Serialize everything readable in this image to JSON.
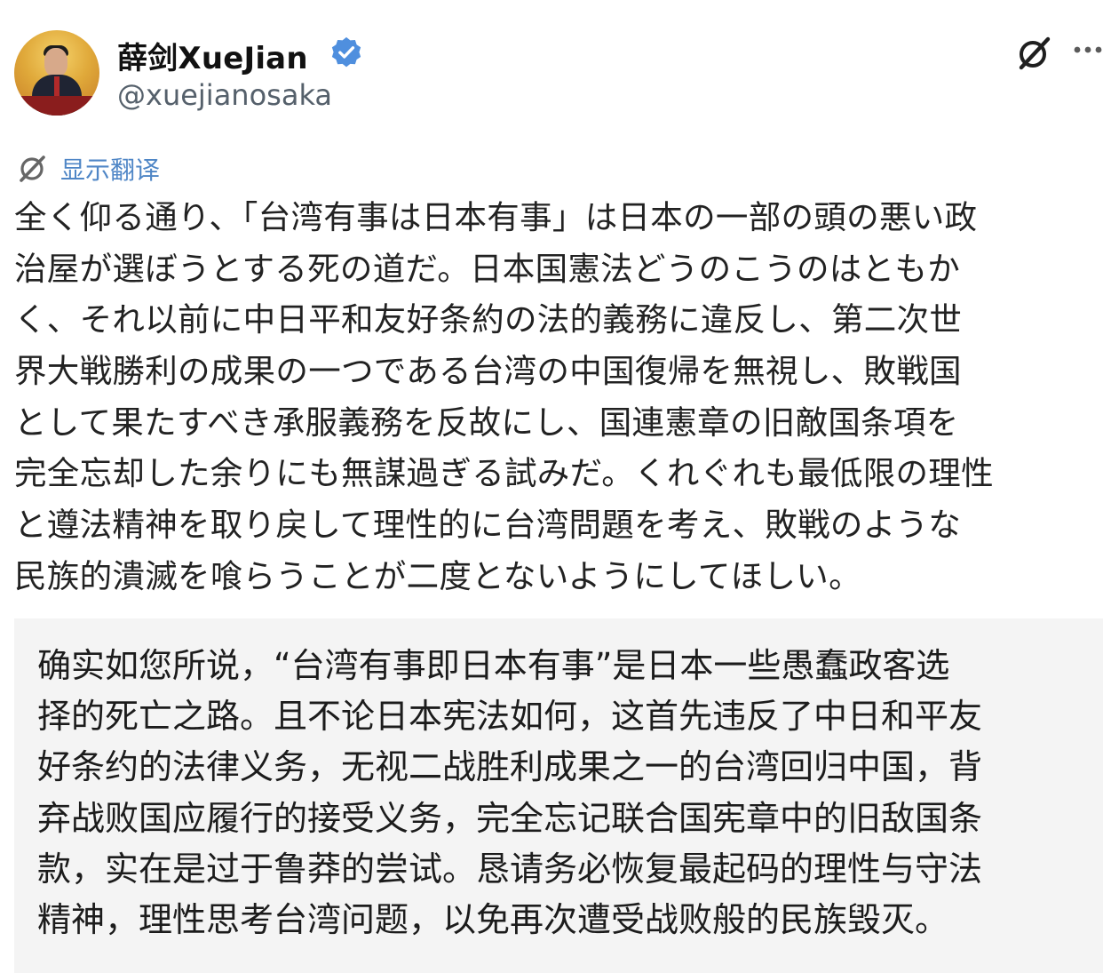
{
  "author": {
    "display_name": "薛剑XueJian",
    "handle": "@xuejianosaka",
    "verified": true,
    "avatar_icon": "avatar-portrait",
    "verified_color": "#4f8fde"
  },
  "actions": {
    "grok_icon": "grok-icon",
    "more_icon": "more-icon"
  },
  "translate": {
    "label": "显示翻译",
    "icon": "translate-icon",
    "link_color": "#4f86c6"
  },
  "post": {
    "lines": [
      "全く仰る通り、「台湾有事は日本有事」は日本の一部の頭の悪い政",
      "治屋が選ぼうとする死の道だ。日本国憲法どうのこうのはともか",
      "く、それ以前に中日平和友好条約の法的義務に違反し、第二次世",
      "界大戦勝利の成果の一つである台湾の中国復帰を無視し、敗戦国",
      "として果たすべき承服義務を反故にし、国連憲章の旧敵国条項を",
      "完全忘却した余りにも無謀過ぎる試みだ。くれぐれも最低限の理性",
      "と遵法精神を取り戻して理性的に台湾問題を考え、敗戦のような",
      "民族的潰滅を喰らうことが二度とないようにしてほしい。"
    ]
  },
  "translation": {
    "lines": [
      "确实如您所说，“台湾有事即日本有事”是日本一些愚蠢政客选",
      "择的死亡之路。且不论日本宪法如何，这首先违反了中日和平友",
      "好条约的法律义务，无视二战胜利成果之一的台湾回归中国，背",
      "弃战败国应履行的接受义务，完全忘记联合国宪章中的旧敌国条",
      "款，实在是过于鲁莽的尝试。恳请务必恢复最起码的理性与守法",
      "精神，理性思考台湾问题，以免再次遭受战败般的民族毁灭。"
    ]
  }
}
